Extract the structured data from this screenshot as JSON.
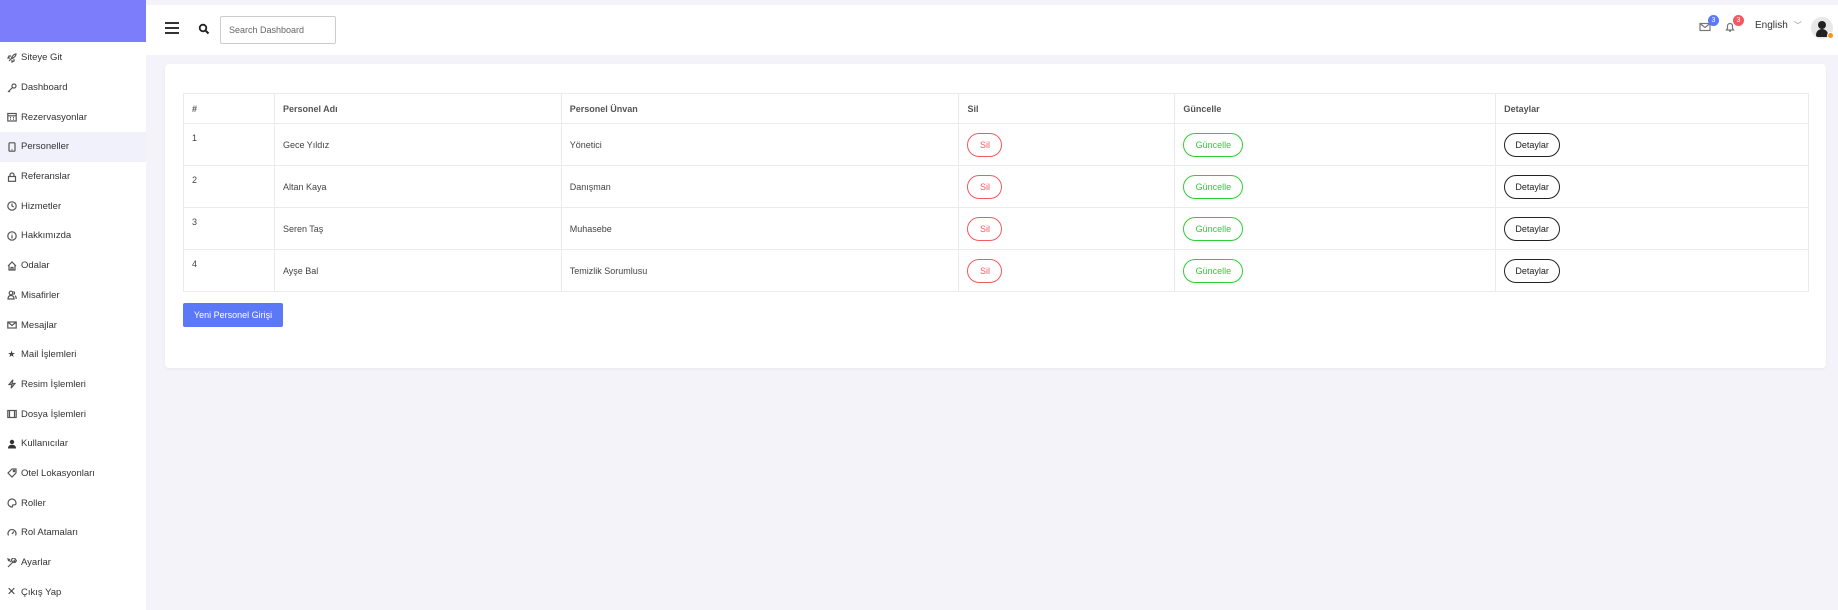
{
  "colors": {
    "brand": "#7c7dfa",
    "background": "#f3f3f9",
    "danger": "#f25961",
    "success": "#31ce36",
    "primary": "#5b78f6",
    "badge_mail": "#5b78f6",
    "badge_notify": "#f25961"
  },
  "sidebar": {
    "items": [
      {
        "label": "Siteye Git",
        "icon": "rocket-icon"
      },
      {
        "label": "Dashboard",
        "icon": "key-icon"
      },
      {
        "label": "Rezervasyonlar",
        "icon": "calendar-icon"
      },
      {
        "label": "Personeller",
        "icon": "device-icon",
        "active": true
      },
      {
        "label": "Referanslar",
        "icon": "lock-icon"
      },
      {
        "label": "Hizmetler",
        "icon": "clock-icon"
      },
      {
        "label": "Hakkımızda",
        "icon": "info-icon"
      },
      {
        "label": "Odalar",
        "icon": "home-icon"
      },
      {
        "label": "Misafirler",
        "icon": "users-icon"
      },
      {
        "label": "Mesajlar",
        "icon": "mail-icon"
      },
      {
        "label": "Mail İşlemleri",
        "icon": "star-icon"
      },
      {
        "label": "Resim İşlemleri",
        "icon": "bolt-icon"
      },
      {
        "label": "Dosya İşlemleri",
        "icon": "film-icon"
      },
      {
        "label": "Kullanıcılar",
        "icon": "user-icon"
      },
      {
        "label": "Otel Lokasyonları",
        "icon": "tag-icon"
      },
      {
        "label": "Roller",
        "icon": "palette-icon"
      },
      {
        "label": "Rol Atamaları",
        "icon": "gauge-icon"
      },
      {
        "label": "Ayarlar",
        "icon": "tools-icon"
      },
      {
        "label": "Çıkış Yap",
        "icon": "close-icon"
      }
    ]
  },
  "topbar": {
    "search_placeholder": "Search Dashboard",
    "mail_badge": "3",
    "notification_badge": "3",
    "language": "English"
  },
  "table": {
    "headers": [
      "#",
      "Personel Adı",
      "Personel Ünvan",
      "Sil",
      "Güncelle",
      "Detaylar"
    ],
    "rows": [
      {
        "id": "1",
        "name": "Gece Yıldız",
        "title": "Yönetici",
        "delete": "Sil",
        "update": "Güncelle",
        "details": "Detaylar"
      },
      {
        "id": "2",
        "name": "Altan Kaya",
        "title": "Danışman",
        "delete": "Sil",
        "update": "Güncelle",
        "details": "Detaylar"
      },
      {
        "id": "3",
        "name": "Seren Taş",
        "title": "Muhasebe",
        "delete": "Sil",
        "update": "Güncelle",
        "details": "Detaylar"
      },
      {
        "id": "4",
        "name": "Ayşe Bal",
        "title": "Temizlik Sorumlusu",
        "delete": "Sil",
        "update": "Güncelle",
        "details": "Detaylar"
      }
    ]
  },
  "new_staff_button": "Yeni Personel Girişi"
}
